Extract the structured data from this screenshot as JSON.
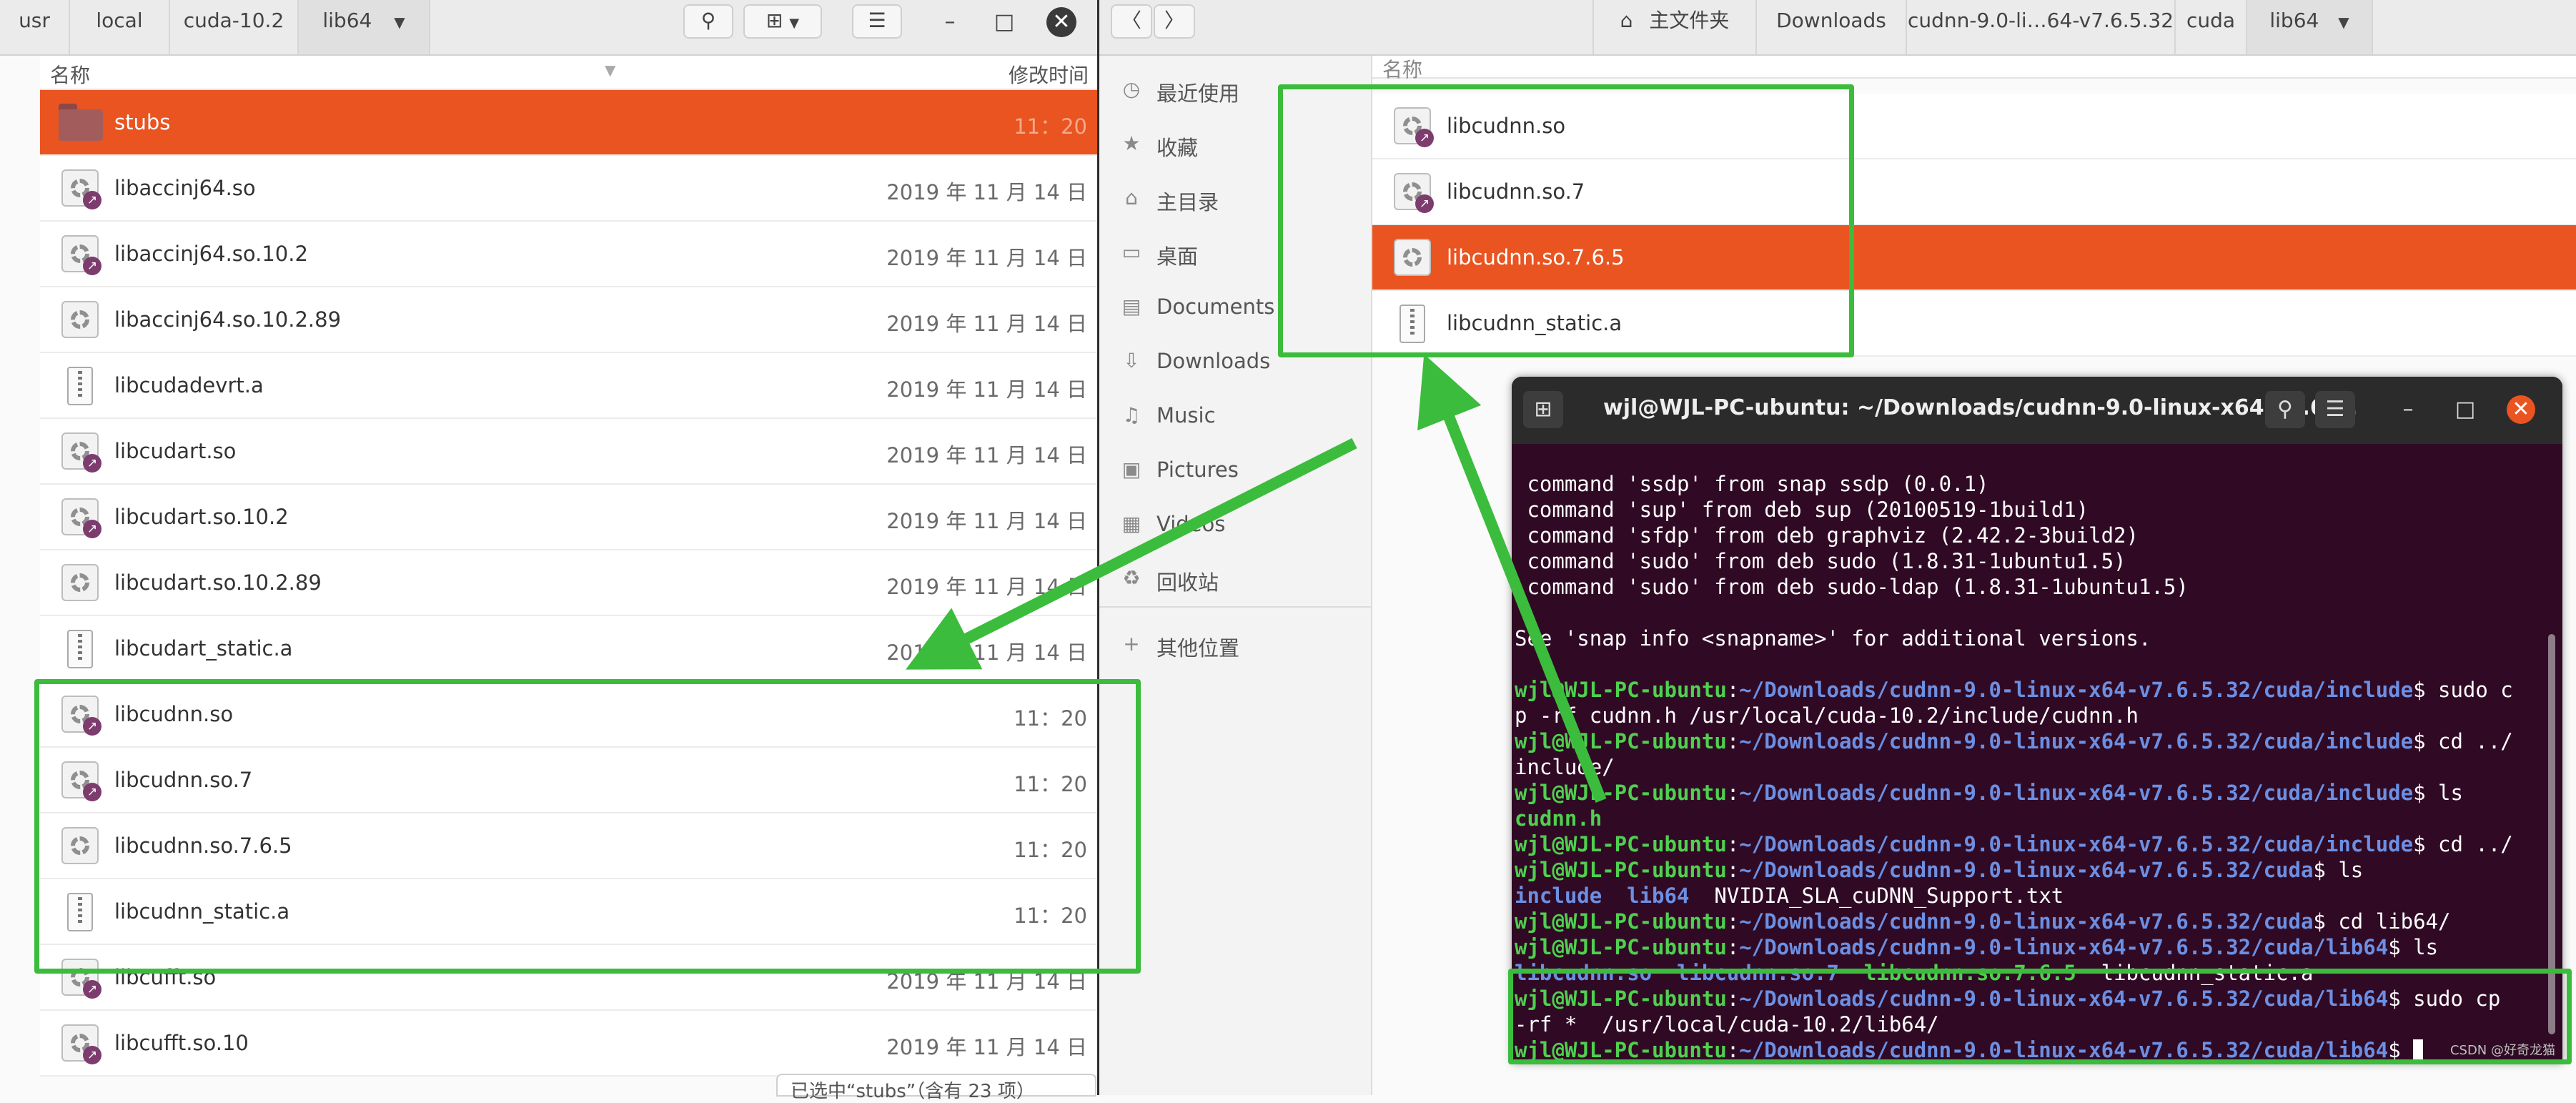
{
  "left": {
    "breadcrumbs": [
      "usr",
      "local",
      "cuda-10.2",
      "lib64"
    ],
    "col_name": "名称",
    "col_modified": "修改时间",
    "files": [
      {
        "name": "stubs",
        "date": "11：20",
        "kind": "folder",
        "selected": true
      },
      {
        "name": "libaccinj64.so",
        "date": "2019 年 11 月 14 日",
        "kind": "link"
      },
      {
        "name": "libaccinj64.so.10.2",
        "date": "2019 年 11 月 14 日",
        "kind": "link"
      },
      {
        "name": "libaccinj64.so.10.2.89",
        "date": "2019 年 11 月 14 日",
        "kind": "lib"
      },
      {
        "name": "libcudadevrt.a",
        "date": "2019 年 11 月 14 日",
        "kind": "archive"
      },
      {
        "name": "libcudart.so",
        "date": "2019 年 11 月 14 日",
        "kind": "link"
      },
      {
        "name": "libcudart.so.10.2",
        "date": "2019 年 11 月 14 日",
        "kind": "link"
      },
      {
        "name": "libcudart.so.10.2.89",
        "date": "2019 年 11 月 14 日",
        "kind": "lib"
      },
      {
        "name": "libcudart_static.a",
        "date": "2019 年 11 月 14 日",
        "kind": "archive"
      },
      {
        "name": "libcudnn.so",
        "date": "11：20",
        "kind": "link"
      },
      {
        "name": "libcudnn.so.7",
        "date": "11：20",
        "kind": "link"
      },
      {
        "name": "libcudnn.so.7.6.5",
        "date": "11：20",
        "kind": "lib"
      },
      {
        "name": "libcudnn_static.a",
        "date": "11：20",
        "kind": "archive"
      },
      {
        "name": "libcufft.so",
        "date": "2019 年 11 月 14 日",
        "kind": "link"
      },
      {
        "name": "libcufft.so.10",
        "date": "2019 年 11 月 14 日",
        "kind": "link"
      }
    ],
    "status": "已选中“stubs”（含有 23 项）"
  },
  "right": {
    "breadcrumbs": [
      "主文件夹",
      "Downloads",
      "cudnn-9.0-li…64-v7.6.5.32",
      "cuda",
      "lib64"
    ],
    "col_name": "名称",
    "sidebar": [
      {
        "label": "最近使用",
        "icon": "◷"
      },
      {
        "label": "收藏",
        "icon": "★"
      },
      {
        "label": "主目录",
        "icon": "⌂"
      },
      {
        "label": "桌面",
        "icon": "▭"
      },
      {
        "label": "Documents",
        "icon": "▤"
      },
      {
        "label": "Downloads",
        "icon": "⇩"
      },
      {
        "label": "Music",
        "icon": "♫"
      },
      {
        "label": "Pictures",
        "icon": "▣"
      },
      {
        "label": "Videos",
        "icon": "▦"
      },
      {
        "label": "回收站",
        "icon": "♻"
      },
      {
        "label": "其他位置",
        "icon": "+"
      }
    ],
    "files": [
      {
        "name": "libcudnn.so",
        "kind": "link"
      },
      {
        "name": "libcudnn.so.7",
        "kind": "link"
      },
      {
        "name": "libcudnn.so.7.6.5",
        "kind": "lib",
        "selected": true
      },
      {
        "name": "libcudnn_static.a",
        "kind": "archive"
      }
    ]
  },
  "terminal": {
    "title": "wjl@WJL-PC-ubuntu: ~/Downloads/cudnn-9.0-linux-x64-v7.6....",
    "lines": [
      [
        {
          "t": " command 'ssdp' from snap ssdp (0.0.1)"
        }
      ],
      [
        {
          "t": " command 'sup' from deb sup (20100519-1build1)"
        }
      ],
      [
        {
          "t": " command 'sfdp' from deb graphviz (2.42.2-3build2)"
        }
      ],
      [
        {
          "t": " command 'sudo' from deb sudo (1.8.31-1ubuntu1.5)"
        }
      ],
      [
        {
          "t": " command 'sudo' from deb sudo-ldap (1.8.31-1ubuntu1.5)"
        }
      ],
      [
        {
          "t": ""
        }
      ],
      [
        {
          "t": "See 'snap info <snapname>' for additional versions."
        }
      ],
      [
        {
          "t": ""
        }
      ],
      [
        {
          "t": "wjl@WJL-PC-ubuntu",
          "c": "pu"
        },
        {
          "t": ":"
        },
        {
          "t": "~/Downloads/cudnn-9.0-linux-x64-v7.6.5.32/cuda/include",
          "c": "pp"
        },
        {
          "t": "$ sudo c"
        }
      ],
      [
        {
          "t": "p -rf cudnn.h /usr/local/cuda-10.2/include/cudnn.h"
        }
      ],
      [
        {
          "t": "wjl@WJL-PC-ubuntu",
          "c": "pu"
        },
        {
          "t": ":"
        },
        {
          "t": "~/Downloads/cudnn-9.0-linux-x64-v7.6.5.32/cuda/include",
          "c": "pp"
        },
        {
          "t": "$ cd ../"
        }
      ],
      [
        {
          "t": "include/"
        }
      ],
      [
        {
          "t": "wjl@WJL-PC-ubuntu",
          "c": "pu"
        },
        {
          "t": ":"
        },
        {
          "t": "~/Downloads/cudnn-9.0-linux-x64-v7.6.5.32/cuda/include",
          "c": "pp"
        },
        {
          "t": "$ ls"
        }
      ],
      [
        {
          "t": "cudnn.h",
          "c": "pg"
        }
      ],
      [
        {
          "t": "wjl@WJL-PC-ubuntu",
          "c": "pu"
        },
        {
          "t": ":"
        },
        {
          "t": "~/Downloads/cudnn-9.0-linux-x64-v7.6.5.32/cuda/include",
          "c": "pp"
        },
        {
          "t": "$ cd ../"
        }
      ],
      [
        {
          "t": "wjl@WJL-PC-ubuntu",
          "c": "pu"
        },
        {
          "t": ":"
        },
        {
          "t": "~/Downloads/cudnn-9.0-linux-x64-v7.6.5.32/cuda",
          "c": "pp"
        },
        {
          "t": "$ ls"
        }
      ],
      [
        {
          "t": "include",
          "c": "pb"
        },
        {
          "t": "  "
        },
        {
          "t": "lib64",
          "c": "pb"
        },
        {
          "t": "  NVIDIA_SLA_cuDNN_Support.txt"
        }
      ],
      [
        {
          "t": "wjl@WJL-PC-ubuntu",
          "c": "pu"
        },
        {
          "t": ":"
        },
        {
          "t": "~/Downloads/cudnn-9.0-linux-x64-v7.6.5.32/cuda",
          "c": "pp"
        },
        {
          "t": "$ cd lib64/"
        }
      ],
      [
        {
          "t": "wjl@WJL-PC-ubuntu",
          "c": "pu"
        },
        {
          "t": ":"
        },
        {
          "t": "~/Downloads/cudnn-9.0-linux-x64-v7.6.5.32/cuda/lib64",
          "c": "pp"
        },
        {
          "t": "$ ls"
        }
      ],
      [
        {
          "t": "libcudnn.so",
          "c": "pp"
        },
        {
          "t": "  "
        },
        {
          "t": "libcudnn.so.7",
          "c": "pp"
        },
        {
          "t": "  "
        },
        {
          "t": "libcudnn.so.7.6.5",
          "c": "pg"
        },
        {
          "t": "  libcudnn_static.a"
        }
      ],
      [
        {
          "t": "wjl@WJL-PC-ubuntu",
          "c": "pu"
        },
        {
          "t": ":"
        },
        {
          "t": "~/Downloads/cudnn-9.0-linux-x64-v7.6.5.32/cuda/lib64",
          "c": "pp"
        },
        {
          "t": "$ sudo cp"
        }
      ],
      [
        {
          "t": "-rf *  /usr/local/cuda-10.2/lib64/"
        }
      ],
      [
        {
          "t": "wjl@WJL-PC-ubuntu",
          "c": "pu"
        },
        {
          "t": ":"
        },
        {
          "t": "~/Downloads/cudnn-9.0-linux-x64-v7.6.5.32/cuda/lib64",
          "c": "pp"
        },
        {
          "t": "$ "
        },
        {
          "t": "",
          "c": "cursor"
        }
      ]
    ],
    "watermark": "CSDN @好奇龙猫"
  },
  "colors": {
    "selection": "#e95420",
    "annotation_green": "#3cbc3c",
    "terminal_bg": "#300a24"
  }
}
